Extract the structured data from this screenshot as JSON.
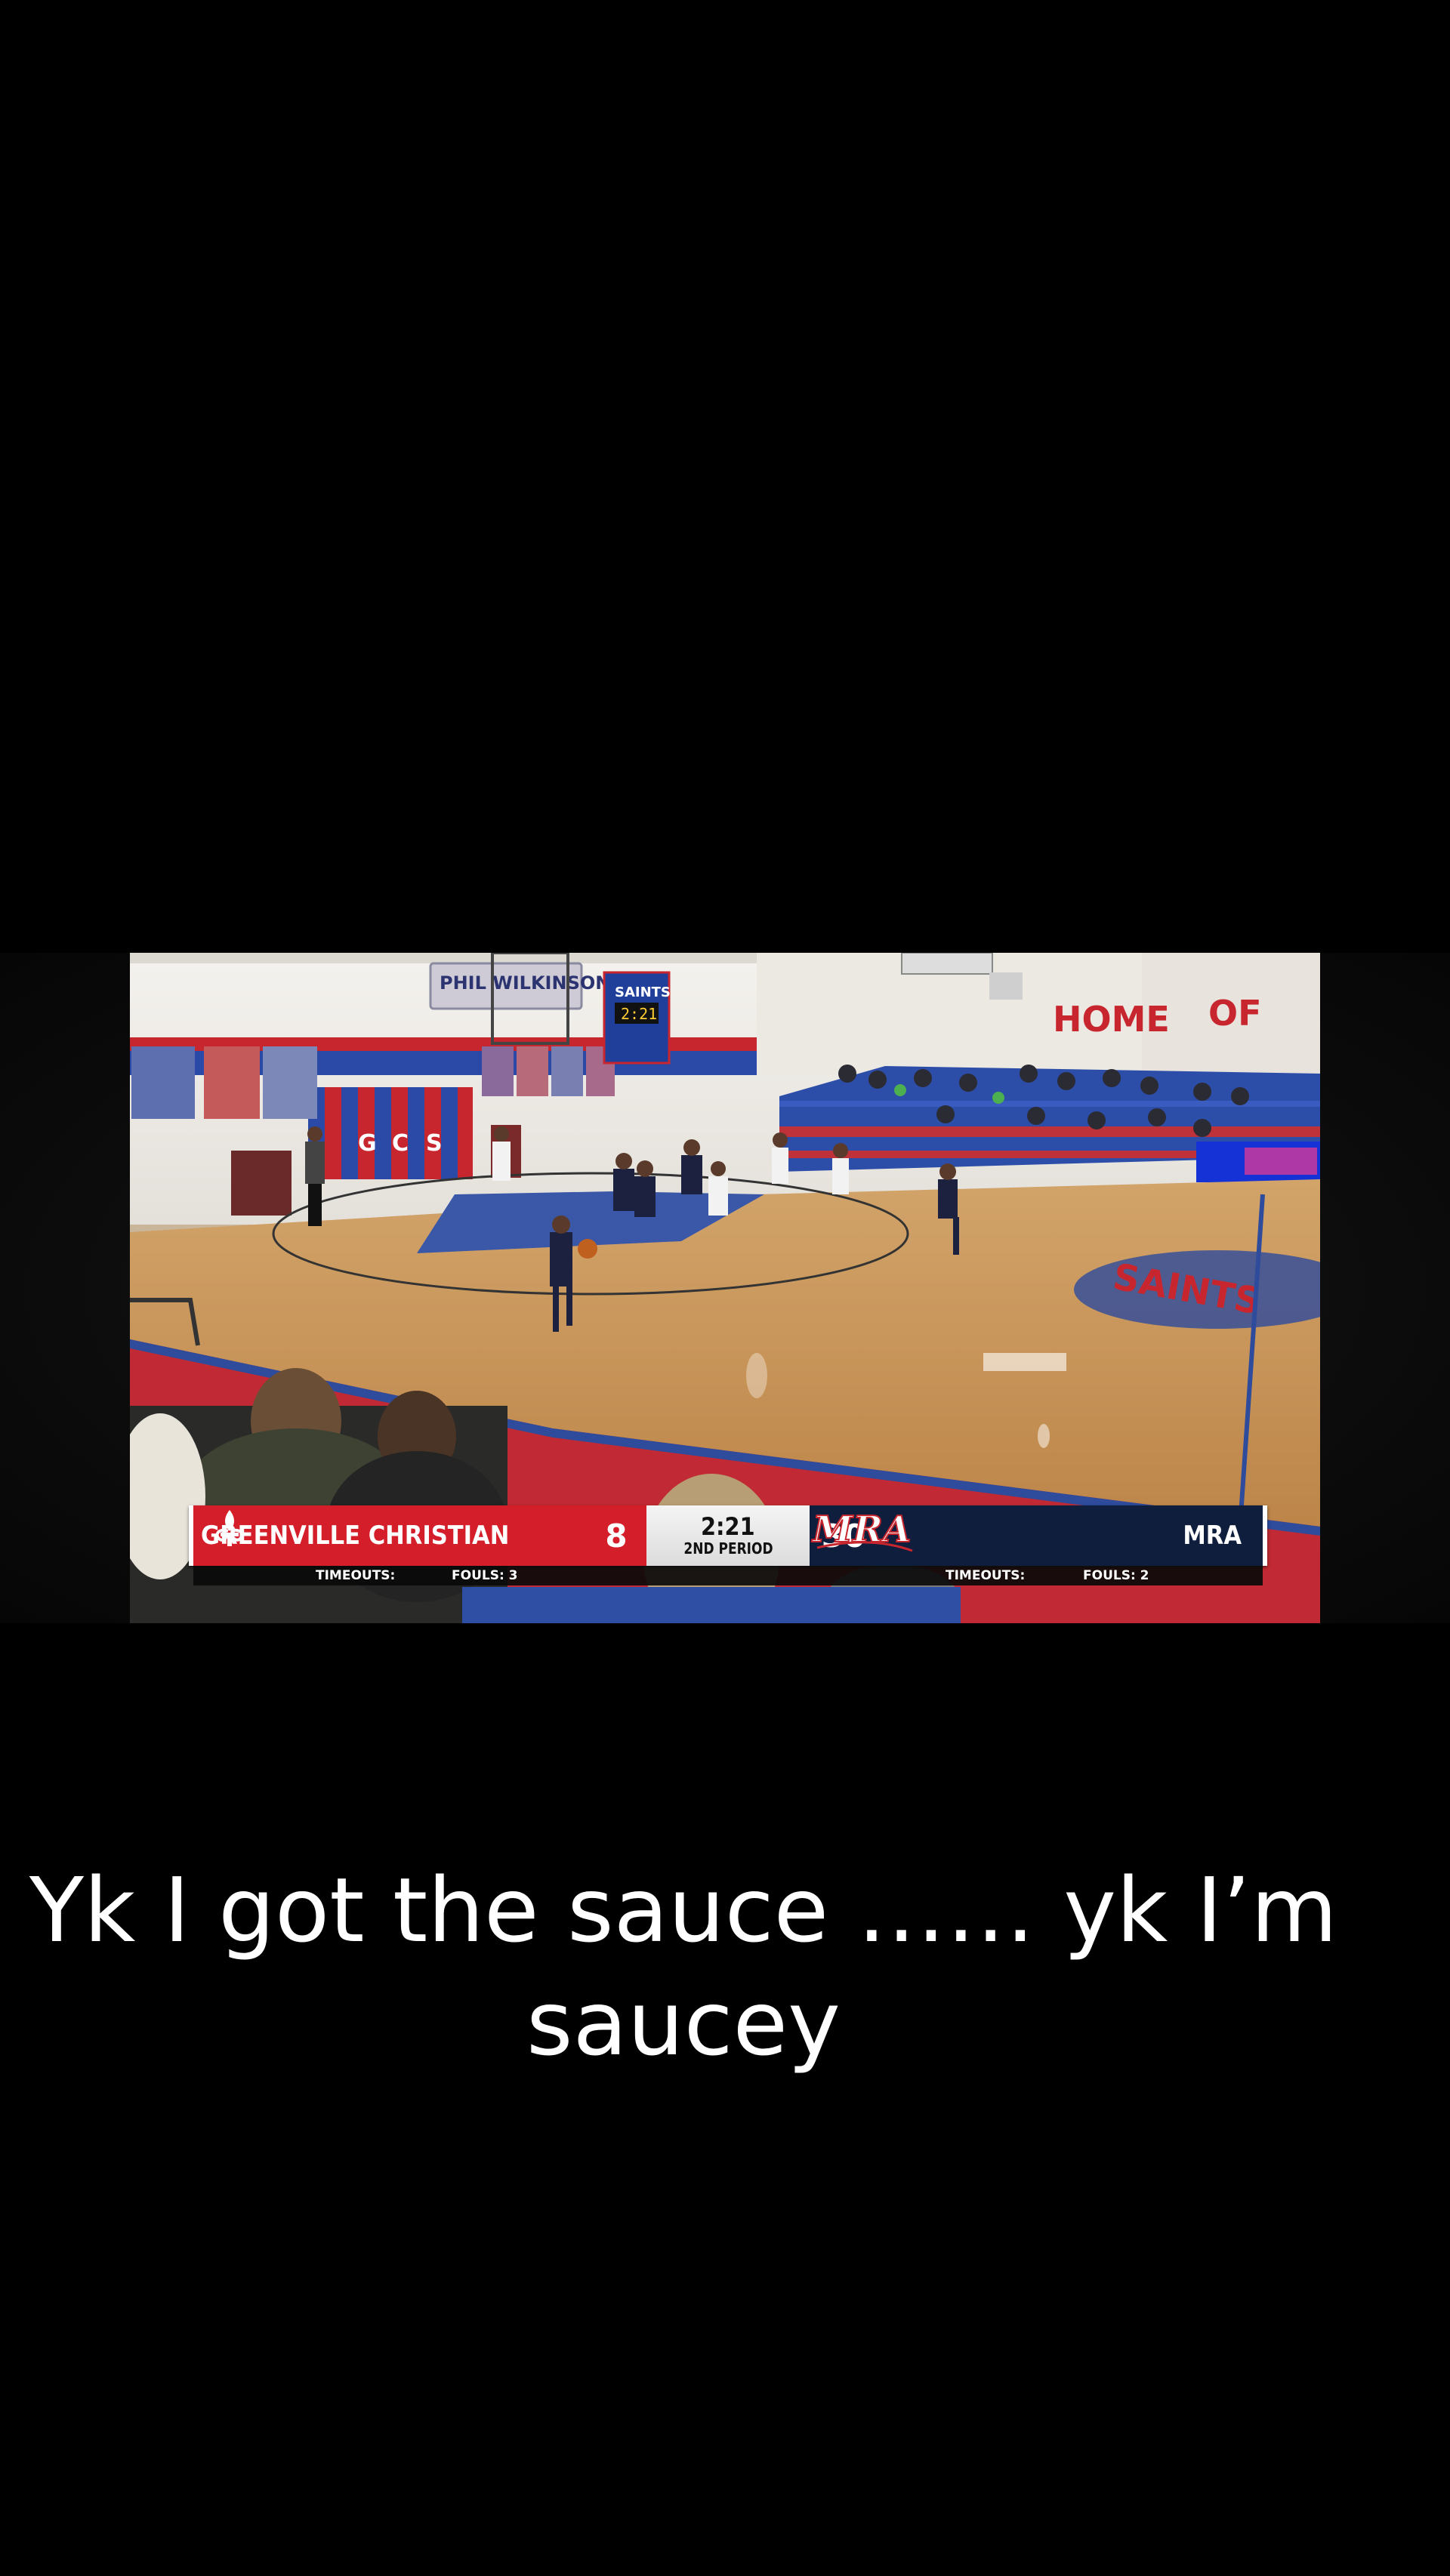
{
  "scoreboard": {
    "home_team": "GREENVILLE CHRISTIAN",
    "home_score": "8",
    "clock": "2:21",
    "period": "2ND PERIOD",
    "away_score": "30",
    "away_team": "MRA",
    "away_logo_text": "MRA",
    "home_timeouts_label": "TIMEOUTS:",
    "home_fouls_label": "FOULS: 3",
    "away_timeouts_label": "TIMEOUTS:",
    "away_fouls_label": "FOULS: 2",
    "home_color": "#d41e2a",
    "away_color": "#0f1e3d"
  },
  "gym": {
    "banner_text": "PHIL WILKINSON",
    "wall_letters": [
      "G",
      "C",
      "S"
    ],
    "home_of_text": [
      "HOME",
      "OF"
    ],
    "wall_scoreboard_title": "SAINTS",
    "wall_scoreboard_clock": "2:21",
    "court_logo_text": "SAINTS"
  },
  "caption": {
    "line1": "Yk I got the sauce …… yk I’m",
    "line2": "saucey"
  }
}
